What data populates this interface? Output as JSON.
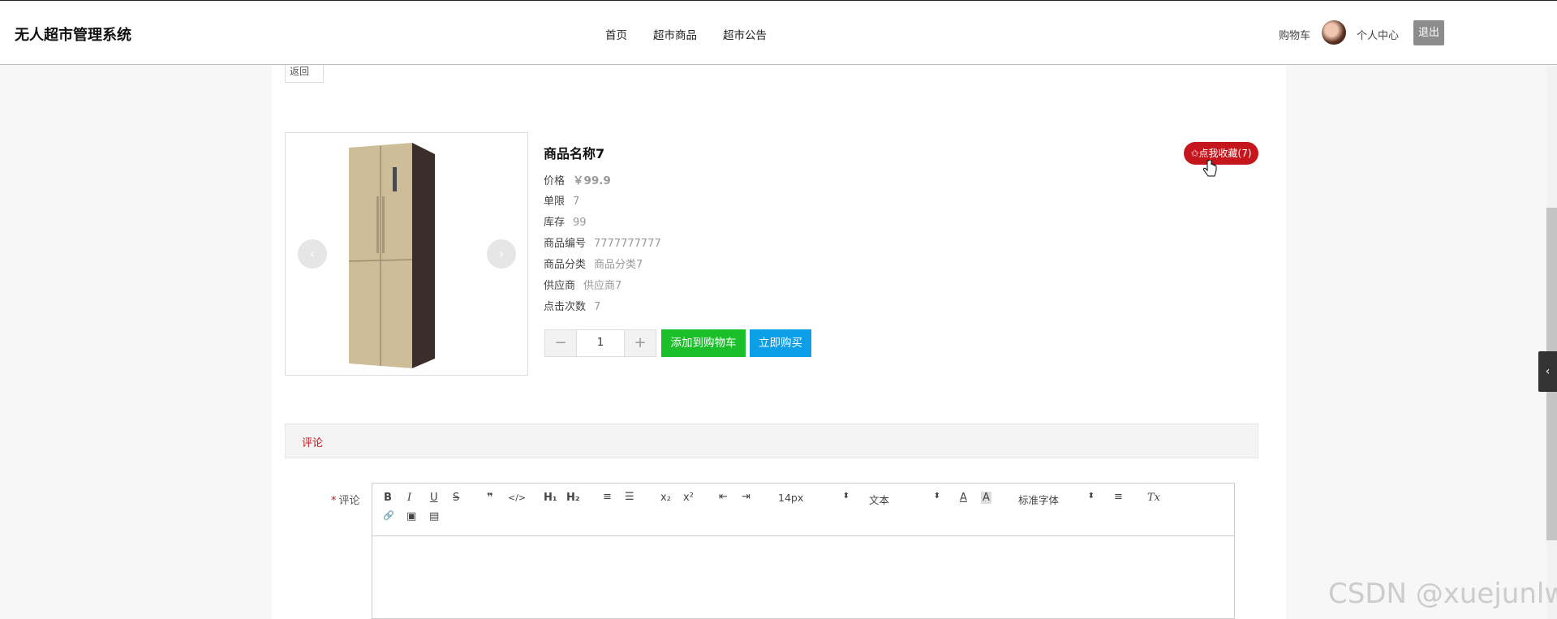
{
  "header": {
    "brand": "无人超市管理系统",
    "nav": [
      "首页",
      "超市商品",
      "超市公告"
    ],
    "cart_label": "购物车",
    "center_label": "个人中心",
    "logout_label": "退出"
  },
  "back_label": "返回",
  "product": {
    "name": "商品名称7",
    "fields": [
      {
        "label": "价格",
        "value": "￥99.9"
      },
      {
        "label": "单限",
        "value": "7"
      },
      {
        "label": "库存",
        "value": "99"
      },
      {
        "label": "商品编号",
        "value": "7777777777"
      },
      {
        "label": "商品分类",
        "value": "商品分类7"
      },
      {
        "label": "供应商",
        "value": "供应商7"
      },
      {
        "label": "点击次数",
        "value": "7"
      }
    ],
    "quantity": "1",
    "minus": "−",
    "plus": "+",
    "add_to_cart": "添加到购物车",
    "buy_now": "立即购买",
    "favorite": "✩点我收藏(7)"
  },
  "carousel": {
    "prev": "‹",
    "next": "›"
  },
  "comment": {
    "tab_label": "评论",
    "form_label": "评论",
    "required_mark": "*"
  },
  "editor": {
    "buttons": {
      "bold": "B",
      "italic": "I",
      "underline": "U",
      "strike": "S",
      "blockquote": "❞",
      "code": "</>",
      "h1": "H₁",
      "h2": "H₂",
      "ordered_list": "≡",
      "bullet_list": "☰",
      "subscript": "x₂",
      "superscript": "x²",
      "outdent": "⇤",
      "indent": "⇥",
      "font_color": "A",
      "bg_color": "A",
      "align": "≡",
      "clean": "Tx",
      "link": "🔗",
      "image": "▣",
      "video": "▤"
    },
    "size_value": "14px",
    "header_value": "文本",
    "font_value": "标准字体",
    "caret": "⬍"
  },
  "side_tab": "‹",
  "watermark": "CSDN @xuejunlw",
  "colors": {
    "favorite": "#c4161c",
    "add_cart": "#1bbf2a",
    "buy_now": "#0d9ee8",
    "logout": "#8c8c8c"
  }
}
